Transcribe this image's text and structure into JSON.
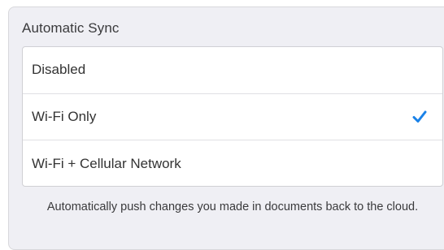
{
  "sync": {
    "title": "Automatic Sync",
    "options": [
      {
        "label": "Disabled",
        "selected": false
      },
      {
        "label": "Wi-Fi Only",
        "selected": true
      },
      {
        "label": "Wi-Fi + Cellular Network",
        "selected": false
      }
    ],
    "footer": "Automatically push changes you made in documents back to the cloud."
  },
  "colors": {
    "accent": "#1a82e8",
    "panel_bg": "#efeff4"
  },
  "icons": {
    "selected": "checkmark-icon"
  }
}
